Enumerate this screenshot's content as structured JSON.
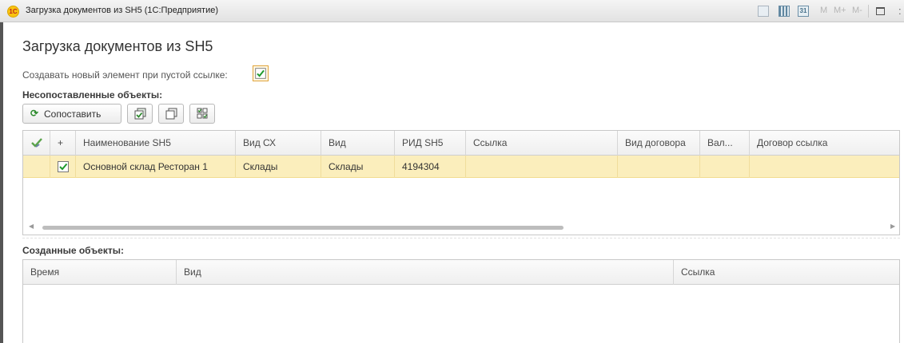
{
  "window": {
    "title": "Загрузка документов из SH5  (1С:Предприятие)",
    "logo_text": "1С",
    "calendar_label": "31",
    "m_buttons": [
      "M",
      "M+",
      "M-"
    ]
  },
  "form": {
    "title": "Загрузка документов из SH5",
    "create_new_label": "Создавать новый элемент при пустой ссылке:",
    "create_new_checked": true
  },
  "unmatched": {
    "section_title": "Несопоставленные объекты:",
    "toolbar": {
      "match_label": "Сопоставить",
      "match_icon": "refresh-icon",
      "check_all_icon": "check-all-icon",
      "uncheck_all_icon": "uncheck-all-icon",
      "invert_icon": "invert-selection-icon"
    },
    "columns": [
      "",
      "+",
      "Наименование SH5",
      "Вид СХ",
      "Вид",
      "РИД SH5",
      "Ссылка",
      "Вид договора",
      "Вал...",
      "Договор ссылка"
    ],
    "rows": [
      {
        "checked": true,
        "name": "Основной склад Ресторан 1",
        "vid_sx": "Склады",
        "vid": "Склады",
        "rid": "4194304",
        "link": "",
        "contract_type": "",
        "currency": "",
        "contract_link": ""
      }
    ],
    "scroll": {
      "thumb_fraction": 0.62
    }
  },
  "created": {
    "section_title": "Созданные объекты:",
    "columns": [
      "Время",
      "Вид",
      "Ссылка"
    ]
  },
  "colors": {
    "selected_row": "#fbeebc",
    "accent_green": "#2e8b2e",
    "checkbox_border": "#e0a43b"
  }
}
